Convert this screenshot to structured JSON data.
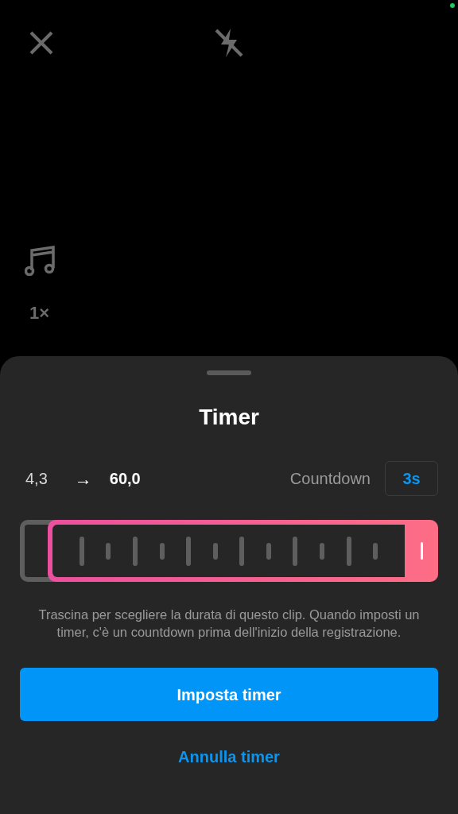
{
  "camera": {
    "speed_label": "1×"
  },
  "sheet": {
    "title": "Timer",
    "range": {
      "start": "4,3",
      "arrow": "→",
      "end": "60,0"
    },
    "countdown": {
      "label": "Countdown",
      "value": "3s"
    },
    "description": "Trascina per scegliere la durata di questo clip. Quando imposti un timer, c'è un countdown prima dell'inizio della registrazione.",
    "buttons": [
      {
        "kind": "primary",
        "label": "Imposta timer"
      },
      {
        "kind": "link",
        "label": "Annulla timer"
      }
    ]
  }
}
